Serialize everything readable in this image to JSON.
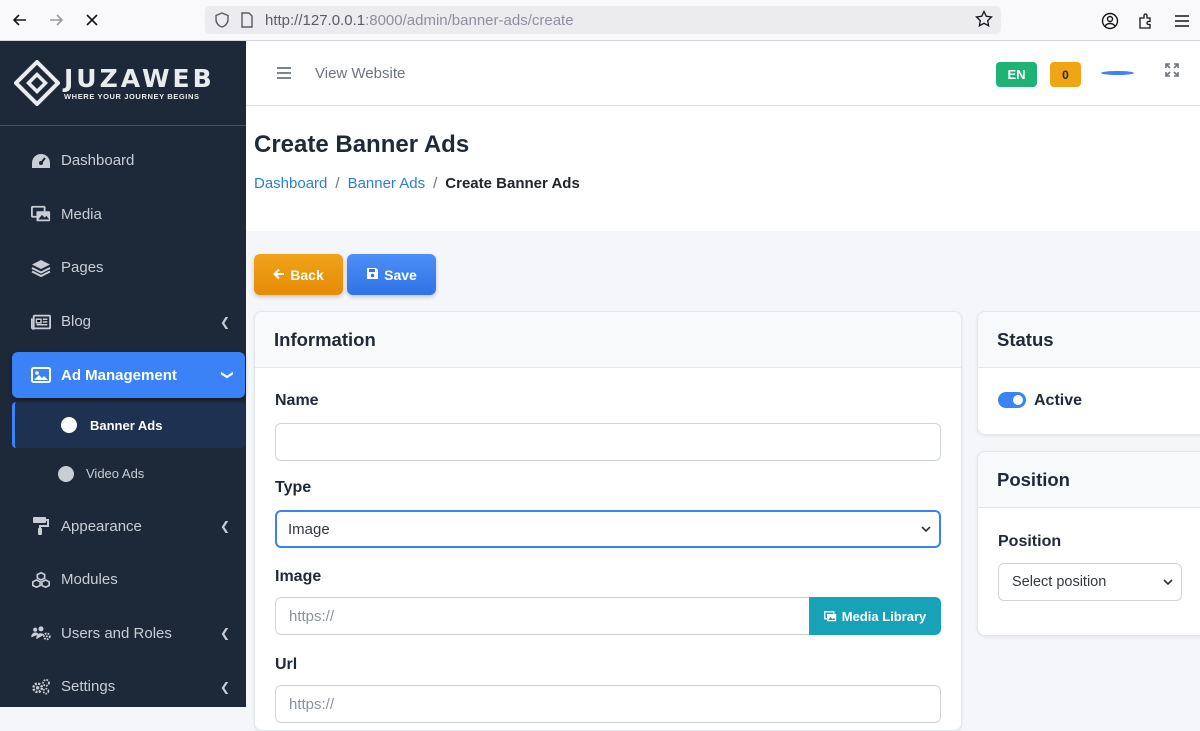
{
  "browser": {
    "url_host": "http://127.0.0.1",
    "url_path": ":8000/admin/banner-ads/create"
  },
  "brand": {
    "title": "JUZAWEB",
    "tagline": "WHERE YOUR JOURNEY BEGINS"
  },
  "sidebar": {
    "items": [
      {
        "label": "Dashboard",
        "icon": "tachometer-icon"
      },
      {
        "label": "Media",
        "icon": "photo-video-icon"
      },
      {
        "label": "Pages",
        "icon": "layers-icon"
      },
      {
        "label": "Blog",
        "icon": "newspaper-icon"
      },
      {
        "label": "Ad Management",
        "icon": "image-icon"
      },
      {
        "label": "Appearance",
        "icon": "paint-roller-icon"
      },
      {
        "label": "Modules",
        "icon": "cubes-icon"
      },
      {
        "label": "Users and Roles",
        "icon": "users-cog-icon"
      },
      {
        "label": "Settings",
        "icon": "cogs-icon"
      }
    ],
    "sub_items": [
      {
        "label": "Banner Ads"
      },
      {
        "label": "Video Ads"
      }
    ]
  },
  "topnav": {
    "view_website": "View Website",
    "lang": "EN",
    "notifications": "0"
  },
  "header": {
    "title": "Create Banner Ads",
    "breadcrumb": [
      "Dashboard",
      "Banner Ads",
      "Create Banner Ads"
    ]
  },
  "actions": {
    "back": "Back",
    "save": "Save"
  },
  "information": {
    "title": "Information",
    "name_label": "Name",
    "name_value": "",
    "type_label": "Type",
    "type_value": "Image",
    "image_label": "Image",
    "image_placeholder": "https://",
    "media_library": "Media Library",
    "url_label": "Url",
    "url_placeholder": "https://"
  },
  "status": {
    "title": "Status",
    "toggle_label": "Active",
    "active": true
  },
  "position": {
    "title": "Position",
    "label": "Position",
    "placeholder": "Select position"
  },
  "colors": {
    "accent": "#3b82f6",
    "sidebar_bg": "#1d2838",
    "back_button": "#e58b06",
    "media_button": "#17a2b8",
    "lang_badge": "#1eb374",
    "notif_badge": "#f0a614"
  }
}
